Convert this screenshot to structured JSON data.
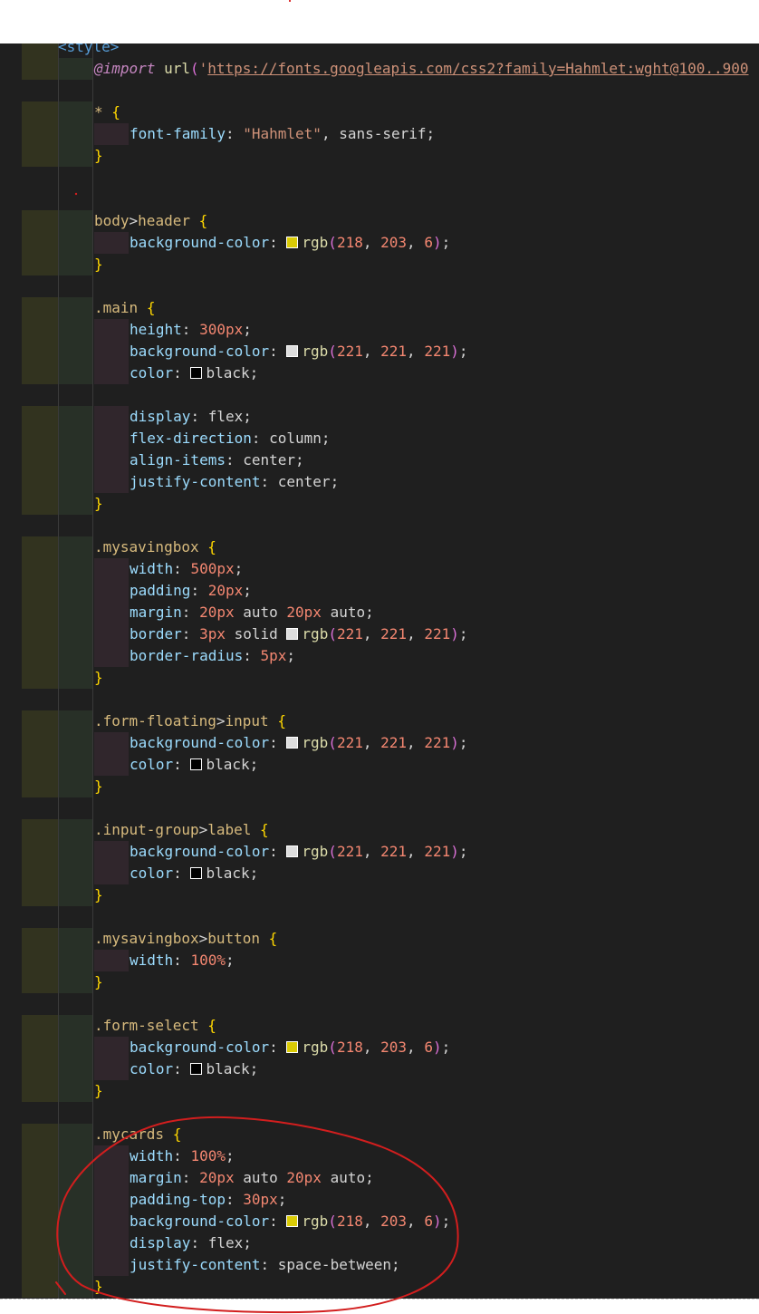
{
  "editor": {
    "lines": [
      {
        "text": "<style>",
        "indent": 0
      },
      {
        "text": "@import url('https://fonts.googleapis.com/css2?family=Hahmlet:wght@100..900",
        "indent": 1
      },
      {
        "text": "",
        "indent": 0
      },
      {
        "text": "* {",
        "indent": 1
      },
      {
        "text": "font-family: \"Hahmlet\", sans-serif;",
        "indent": 2
      },
      {
        "text": "}",
        "indent": 1
      },
      {
        "text": "",
        "indent": 0
      },
      {
        "text": "",
        "indent": 0
      },
      {
        "text": "body>header {",
        "indent": 1
      },
      {
        "text": "background-color: rgb(218, 203, 6);",
        "indent": 2,
        "swatch": "#dacb06"
      },
      {
        "text": "}",
        "indent": 1
      },
      {
        "text": "",
        "indent": 0
      },
      {
        "text": ".main {",
        "indent": 1
      },
      {
        "text": "height: 300px;",
        "indent": 2
      },
      {
        "text": "background-color: rgb(221, 221, 221);",
        "indent": 2,
        "swatch": "#dddddd"
      },
      {
        "text": "color: black;",
        "indent": 2,
        "swatch": "#000000"
      },
      {
        "text": "",
        "indent": 0
      },
      {
        "text": "display: flex;",
        "indent": 2
      },
      {
        "text": "flex-direction: column;",
        "indent": 2
      },
      {
        "text": "align-items: center;",
        "indent": 2
      },
      {
        "text": "justify-content: center;",
        "indent": 2
      },
      {
        "text": "}",
        "indent": 1
      },
      {
        "text": "",
        "indent": 0
      },
      {
        "text": ".mysavingbox {",
        "indent": 1
      },
      {
        "text": "width: 500px;",
        "indent": 2
      },
      {
        "text": "padding: 20px;",
        "indent": 2
      },
      {
        "text": "margin: 20px auto 20px auto;",
        "indent": 2
      },
      {
        "text": "border: 3px solid rgb(221, 221, 221);",
        "indent": 2,
        "swatch": "#dddddd"
      },
      {
        "text": "border-radius: 5px;",
        "indent": 2
      },
      {
        "text": "}",
        "indent": 1
      },
      {
        "text": "",
        "indent": 0
      },
      {
        "text": ".form-floating>input {",
        "indent": 1
      },
      {
        "text": "background-color: rgb(221, 221, 221);",
        "indent": 2,
        "swatch": "#dddddd"
      },
      {
        "text": "color: black;",
        "indent": 2,
        "swatch": "#000000"
      },
      {
        "text": "}",
        "indent": 1
      },
      {
        "text": "",
        "indent": 0
      },
      {
        "text": ".input-group>label {",
        "indent": 1
      },
      {
        "text": "background-color: rgb(221, 221, 221);",
        "indent": 2,
        "swatch": "#dddddd"
      },
      {
        "text": "color: black;",
        "indent": 2,
        "swatch": "#000000"
      },
      {
        "text": "}",
        "indent": 1
      },
      {
        "text": "",
        "indent": 0
      },
      {
        "text": ".mysavingbox>button {",
        "indent": 1
      },
      {
        "text": "width: 100%;",
        "indent": 2
      },
      {
        "text": "}",
        "indent": 1
      },
      {
        "text": "",
        "indent": 0
      },
      {
        "text": ".form-select {",
        "indent": 1
      },
      {
        "text": "background-color: rgb(218, 203, 6);",
        "indent": 2,
        "swatch": "#dacb06"
      },
      {
        "text": "color: black;",
        "indent": 2,
        "swatch": "#000000"
      },
      {
        "text": "}",
        "indent": 1
      },
      {
        "text": "",
        "indent": 0
      },
      {
        "text": ".mycards {",
        "indent": 1
      },
      {
        "text": "width: 100%;",
        "indent": 2
      },
      {
        "text": "margin: 20px auto 20px auto;",
        "indent": 2
      },
      {
        "text": "padding-top: 30px;",
        "indent": 2
      },
      {
        "text": "background-color: rgb(218, 203, 6);",
        "indent": 2,
        "swatch": "#dacb06"
      },
      {
        "text": "display: flex;",
        "indent": 2
      },
      {
        "text": "justify-content: space-between;",
        "indent": 2
      },
      {
        "text": "}",
        "indent": 1
      }
    ]
  },
  "theme": {
    "background": "#1f1f1f",
    "annotation_color": "#d21e1e"
  }
}
